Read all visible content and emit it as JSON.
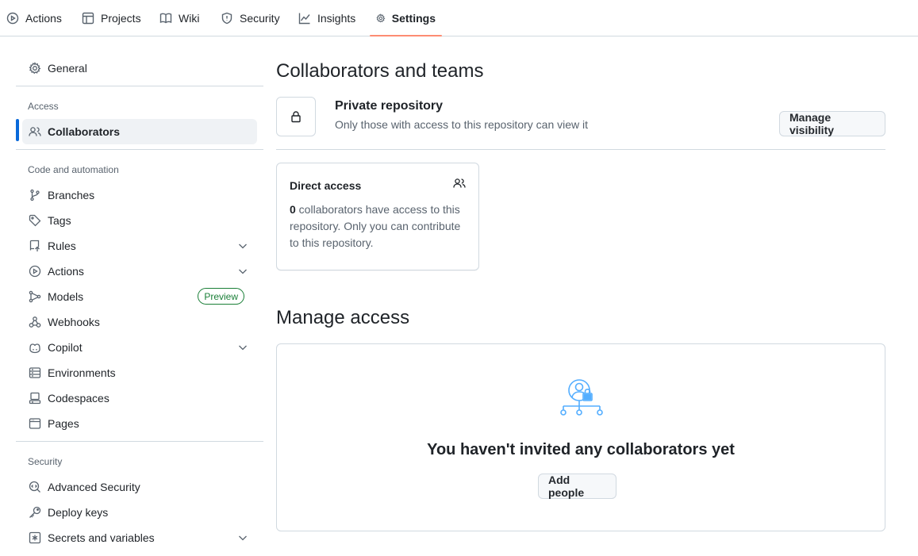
{
  "topnav": {
    "tabs": [
      {
        "label": "Actions",
        "icon": "play-circle-icon"
      },
      {
        "label": "Projects",
        "icon": "table-icon"
      },
      {
        "label": "Wiki",
        "icon": "book-icon"
      },
      {
        "label": "Security",
        "icon": "shield-icon"
      },
      {
        "label": "Insights",
        "icon": "graph-icon"
      },
      {
        "label": "Settings",
        "icon": "gear-icon",
        "active": true
      }
    ]
  },
  "sidebar": {
    "general": "General",
    "access_heading": "Access",
    "collaborators": "Collaborators",
    "code_heading": "Code and automation",
    "branches": "Branches",
    "tags": "Tags",
    "rules": "Rules",
    "actions": "Actions",
    "models": "Models",
    "models_badge": "Preview",
    "webhooks": "Webhooks",
    "copilot": "Copilot",
    "environments": "Environments",
    "codespaces": "Codespaces",
    "pages": "Pages",
    "security_heading": "Security",
    "advanced_security": "Advanced Security",
    "deploy_keys": "Deploy keys",
    "secrets": "Secrets and variables"
  },
  "main": {
    "title": "Collaborators and teams",
    "visibility_title": "Private repository",
    "visibility_desc": "Only those with access to this repository can view it",
    "manage_visibility": "Manage visibility",
    "direct_access_title": "Direct access",
    "direct_access_count": "0",
    "direct_access_text": " collaborators have access to this repository. Only you can contribute to this repository.",
    "manage_access_title": "Manage access",
    "empty_title": "You haven't invited any collaborators yet",
    "add_people": "Add people"
  },
  "colors": {
    "accent": "#0969da",
    "tab_underline": "#fd8c73",
    "badge_green": "#1a7f37",
    "illustration_blue": "#54aeff"
  }
}
